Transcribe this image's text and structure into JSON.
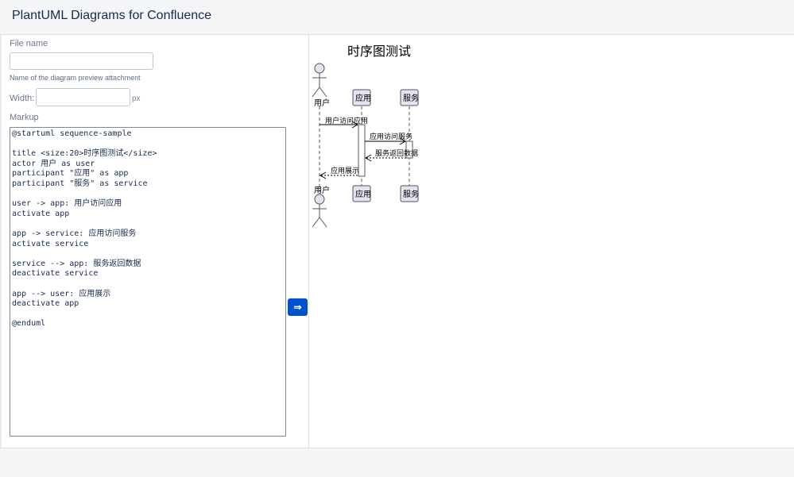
{
  "header": {
    "title": "PlantUML Diagrams for Confluence"
  },
  "form": {
    "file_name_label": "File name",
    "file_name_value": "",
    "file_name_hint": "Name of the diagram preview attachment",
    "width_label": "Width:",
    "width_value": "",
    "width_unit": "px",
    "markup_label": "Markup",
    "markup_value": "@startuml sequence-sample\n\ntitle <size:20>时序图测试</size>\nactor 用户 as user\nparticipant \"应用\" as app\nparticipant \"服务\" as service\n\nuser -> app: 用户访问应用\nactivate app\n\napp -> service: 应用访问服务\nactivate service\n\nservice --> app: 服务返回数据\ndeactivate service\n\napp --> user: 应用展示\ndeactivate app\n\n@enduml"
  },
  "convert_button": {
    "label": "⇒",
    "icon": "arrow-right-icon",
    "color": "#0052cc"
  },
  "diagram": {
    "title": "时序图测试",
    "participants": [
      {
        "id": "user",
        "kind": "actor",
        "label": "用户"
      },
      {
        "id": "app",
        "kind": "participant",
        "label": "应用"
      },
      {
        "id": "service",
        "kind": "participant",
        "label": "服务"
      }
    ],
    "messages": [
      {
        "from": "user",
        "to": "app",
        "label": "用户访问应用",
        "style": "solid"
      },
      {
        "from": "app",
        "to": "service",
        "label": "应用访问服务",
        "style": "solid"
      },
      {
        "from": "service",
        "to": "app",
        "label": "服务返回数据",
        "style": "dashed"
      },
      {
        "from": "app",
        "to": "user",
        "label": "应用展示",
        "style": "dashed"
      }
    ],
    "participant_fill": "#e2e2f0"
  }
}
